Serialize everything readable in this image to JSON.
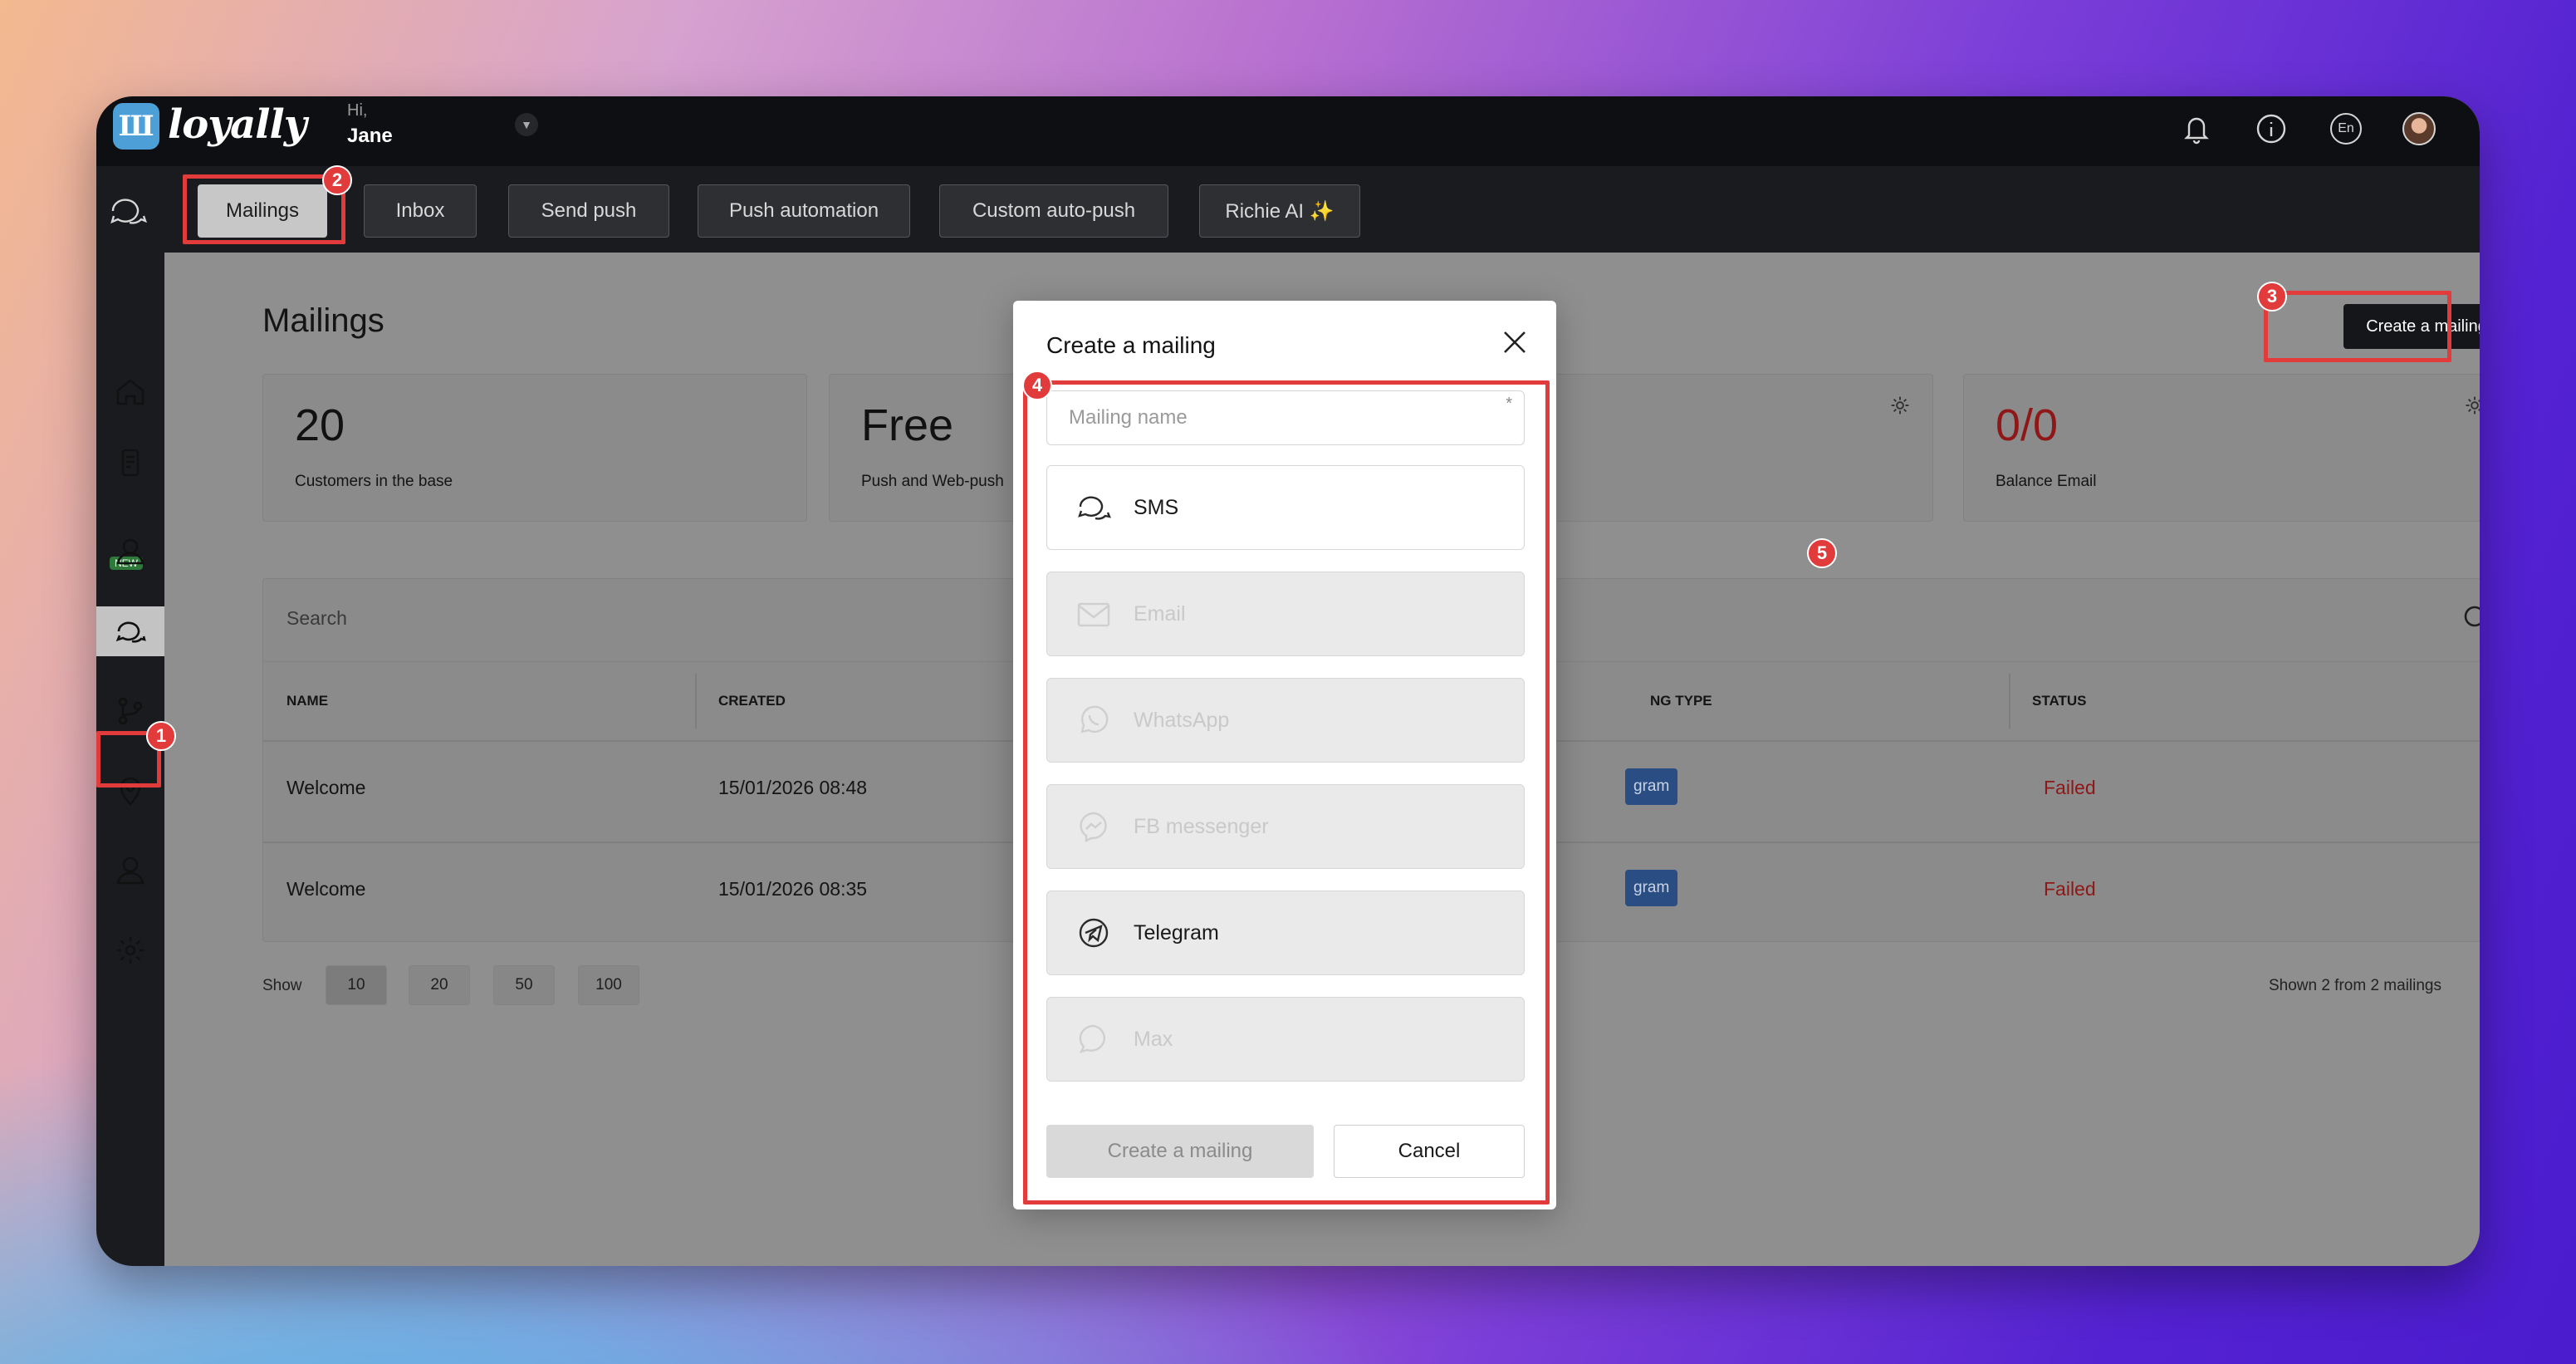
{
  "app": {
    "logo_letter": "Ш",
    "logo_text": "loyally",
    "greeting": "Hi,",
    "user_name": "Jane",
    "language": "En",
    "accent_color": "#e23b3b"
  },
  "topbar_icons": [
    "bell-icon",
    "info-icon",
    "language-icon",
    "avatar"
  ],
  "tabs": [
    {
      "label": "Mailings",
      "active": true
    },
    {
      "label": "Inbox"
    },
    {
      "label": "Send push"
    },
    {
      "label": "Push automation"
    },
    {
      "label": "Custom auto-push"
    },
    {
      "label": "Richie AI ✨"
    }
  ],
  "sidebar": {
    "new_badge": "NEW",
    "icons": [
      "home-icon",
      "phone-card-icon",
      "customers-icon",
      "chat-icon",
      "branch-icon",
      "location-icon",
      "user-icon",
      "gear-icon"
    ]
  },
  "page": {
    "title": "Mailings",
    "create_button": "Create a mailing"
  },
  "cards": [
    {
      "value": "20",
      "label": "Customers in the base"
    },
    {
      "value": "Free",
      "label": "Push and Web-push"
    },
    {
      "value": "0/0",
      "label": "Balance Email",
      "color": "#8f1717"
    }
  ],
  "search": {
    "placeholder": "Search"
  },
  "table": {
    "columns": [
      "NAME",
      "CREATED",
      "NG TYPE",
      "STATUS"
    ],
    "rows": [
      {
        "name": "Welcome",
        "created": "15/01/2026 08:48",
        "type": "gram",
        "status": "Failed"
      },
      {
        "name": "Welcome",
        "created": "15/01/2026 08:35",
        "type": "gram",
        "status": "Failed"
      }
    ]
  },
  "pagination": {
    "show_label": "Show",
    "sizes": [
      "10",
      "20",
      "50",
      "100"
    ],
    "summary": "Shown 2 from 2 mailings"
  },
  "modal": {
    "title": "Create a mailing",
    "name_placeholder": "Mailing name",
    "required_mark": "*",
    "channels": [
      {
        "label": "SMS",
        "icon": "chat-icon",
        "enabled": true
      },
      {
        "label": "Email",
        "icon": "mail-icon",
        "enabled": false
      },
      {
        "label": "WhatsApp",
        "icon": "whatsapp-icon",
        "enabled": false
      },
      {
        "label": "FB messenger",
        "icon": "messenger-icon",
        "enabled": false
      },
      {
        "label": "Telegram",
        "icon": "telegram-icon",
        "enabled": true
      },
      {
        "label": "Max",
        "icon": "max-icon",
        "enabled": false
      }
    ],
    "create_button": "Create a mailing",
    "cancel_button": "Cancel"
  },
  "annotations": [
    "1",
    "2",
    "3",
    "4",
    "5"
  ]
}
